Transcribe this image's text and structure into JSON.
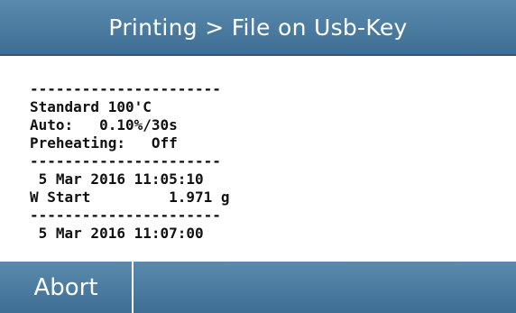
{
  "header": {
    "title": "Printing > File on Usb-Key"
  },
  "printout": {
    "lines": [
      "----------------------",
      "Standard 100'C",
      "Auto:   0.10%/30s",
      "Preheating:   Off",
      "----------------------",
      " 5 Mar 2016 11:05:10",
      "W Start         1.971 g",
      "----------------------",
      " 5 Mar 2016 11:07:00"
    ]
  },
  "footer": {
    "abort_label": "Abort"
  },
  "colors": {
    "bar_top": "#5a8aae",
    "bar_bottom": "#3f6e94",
    "text_dark": "#111111"
  }
}
